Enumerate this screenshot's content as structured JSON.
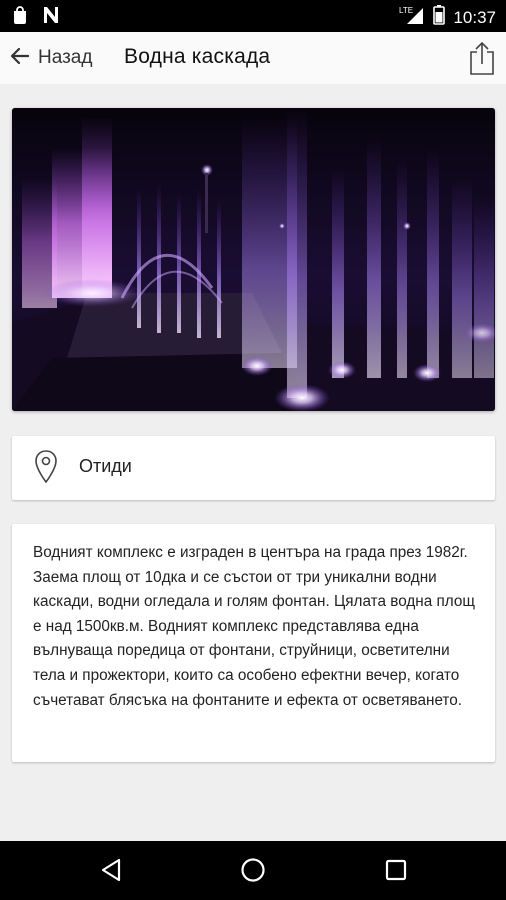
{
  "status_bar": {
    "time": "10:37",
    "network_label": "LTE",
    "icons": [
      "shopping-bag-icon",
      "n-logo-icon",
      "signal-icon",
      "battery-icon"
    ]
  },
  "app_bar": {
    "back_label": "Назад",
    "title": "Водна каскада",
    "icons": [
      "arrow-left-icon",
      "share-icon"
    ]
  },
  "photo": {
    "alt": "fountain-photo",
    "colors": {
      "sky": "#07040d",
      "water": "#b48cff",
      "glow": "#7a3bd6"
    }
  },
  "go_card": {
    "label": "Отиди",
    "icon": "location-pin-icon"
  },
  "description": {
    "text": "Водният комплекс е изграден в центъра на града през 1982г. Заема площ от 10дка и се състои от три уникални водни каскади, водни огледала и голям фонтан. Цялата водна площ е над 1500кв.м. Водният комплекс представлява една вълнуваща поредица от фонтани, струйници, осветителни тела и прожектори, които са особено ефектни вечер, когато съчетават блясъка на фонтаните и ефекта от осветяването."
  },
  "nav_bar": {
    "buttons": [
      "back-triangle-icon",
      "home-circle-icon",
      "recents-square-icon"
    ]
  }
}
